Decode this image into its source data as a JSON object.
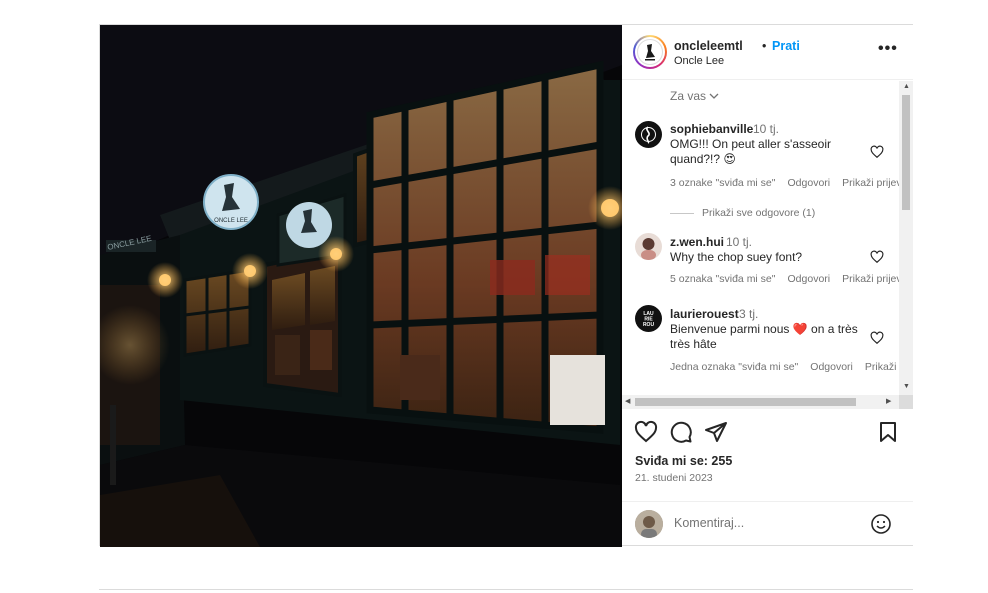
{
  "post": {
    "username": "oncleleemtl",
    "separator": "•",
    "follow_label": "Prati",
    "subtitle": "Oncle Lee",
    "more_icon": "more-horizontal-icon",
    "more_label": "•••",
    "media": {
      "sign_text": "ONCLE LEE",
      "second_sign_text": "ONCLE LEE"
    }
  },
  "comments": {
    "filter_label": "Za vas",
    "items": [
      {
        "username": "sophiebanville",
        "time": "10 tj.",
        "text_line1": "OMG!!! On peut aller s'asseoir",
        "text_line2": "quand?!? 😍",
        "likes": "3 oznake \"sviđa mi se\"",
        "reply": "Odgovori",
        "translate": "Prikaži prijevod"
      },
      {
        "username": "z.wen.hui",
        "time": "10 tj.",
        "text_line1": "Why the chop suey font?",
        "likes": "5 oznaka \"sviđa mi se\"",
        "reply": "Odgovori",
        "translate": "Prikaži prijevod"
      },
      {
        "username": "laurierouest",
        "time": "3 tj.",
        "text_line1": "Bienvenue parmi nous ❤️ on a très",
        "text_line2": "très hâte",
        "likes": "Jedna oznaka \"sviđa mi se\"",
        "reply": "Odgovori",
        "translate": "Prikaži prijevod"
      }
    ],
    "view_replies": "Prikaži sve odgovore (1)",
    "avatar_badge_text": "LAU RIE ROU EST"
  },
  "actions": {
    "likes_label": "Sviđa mi se: 255",
    "date": "21. studeni 2023"
  },
  "composer": {
    "placeholder": "Komentiraj..."
  },
  "colors": {
    "accent": "#0095f6",
    "text": "#262626",
    "muted": "#737373",
    "border": "#dbdbdb"
  }
}
